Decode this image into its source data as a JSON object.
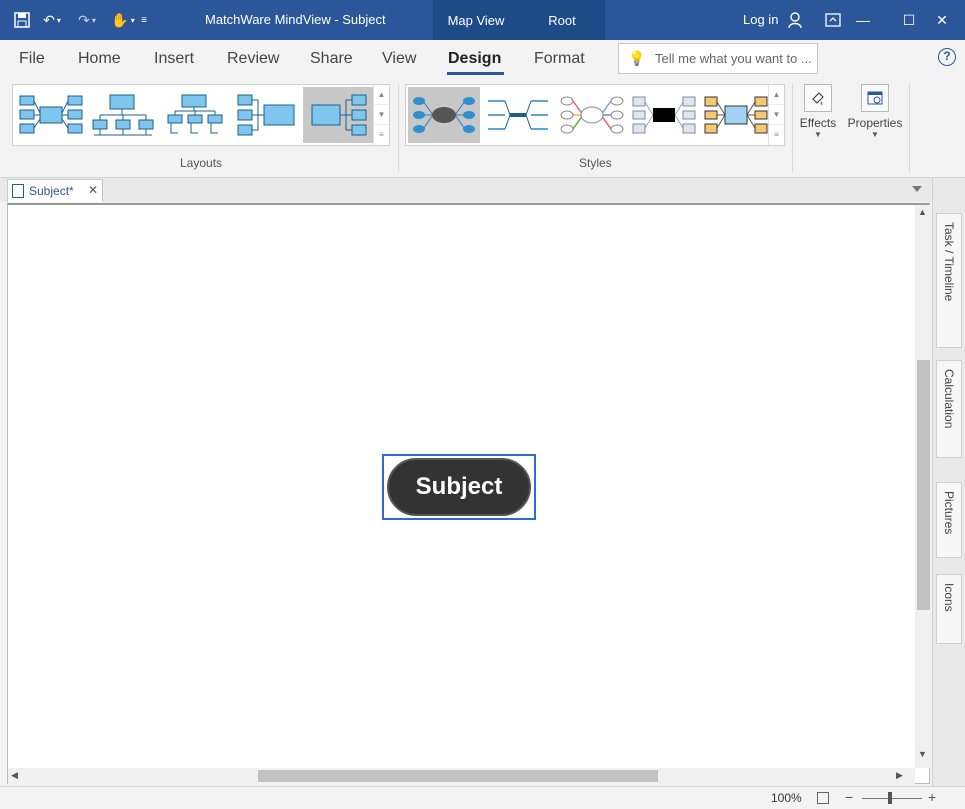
{
  "window": {
    "title": "MatchWare MindView - Subject",
    "context_tabs": [
      "Map View",
      "Root"
    ],
    "login": "Log in"
  },
  "ribbon": {
    "tabs": [
      {
        "label": "File"
      },
      {
        "label": "Home"
      },
      {
        "label": "Insert"
      },
      {
        "label": "Review"
      },
      {
        "label": "Share"
      },
      {
        "label": "View"
      },
      {
        "label": "Design"
      },
      {
        "label": "Format"
      }
    ],
    "active_tab": "Design",
    "tell_me_placeholder": "Tell me what you want to ...",
    "groups": {
      "layouts": "Layouts",
      "styles": "Styles"
    },
    "buttons": {
      "effects": "Effects",
      "properties": "Properties"
    }
  },
  "document": {
    "tab_label": "Subject*",
    "root_node": "Subject"
  },
  "side_panel": {
    "tabs": [
      "Task / Timeline",
      "Calculation",
      "Pictures",
      "Icons"
    ]
  },
  "status": {
    "zoom": "100%"
  },
  "colors": {
    "title_bar": "#2b579a",
    "node_fill": "#333333",
    "selection": "#2f6bd3",
    "layout_blue": "#7ec6ee"
  }
}
